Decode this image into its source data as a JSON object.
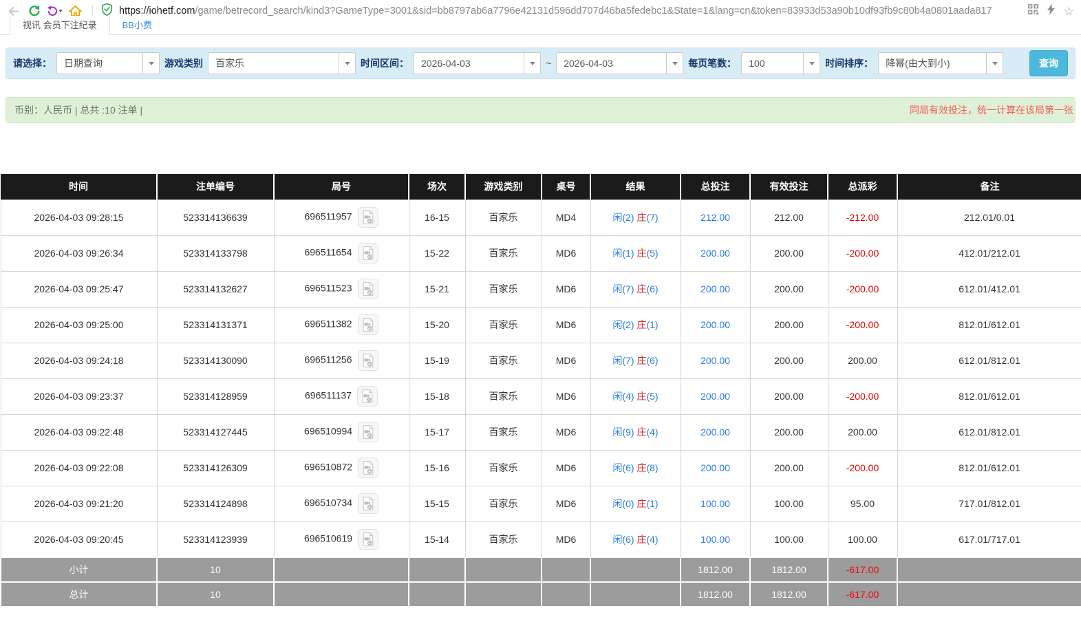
{
  "browser": {
    "url_host": "https://iohetf.com",
    "url_path": "/game/betrecord_search/kind3?GameType=3001&sid=bb8797ab6a7796e42131d596dd707d46ba5fedebc1&State=1&lang=cn&token=83933d53a90b10df93fb9c80b4a0801aada817",
    "icons": [
      "back-arrow",
      "refresh",
      "undo-history",
      "home",
      "security-shield",
      "qr-code",
      "lightning",
      "bookmark-star"
    ]
  },
  "tabs": [
    {
      "label": "视讯 会员下注纪录",
      "active": true
    },
    {
      "label": "BB小费",
      "active": false
    }
  ],
  "filters": {
    "select_label": "请选择：",
    "query_type": "日期查询",
    "game_category_label": "游戏类别",
    "game_category": "百家乐",
    "time_range_label": "时间区间：",
    "date_from": "2026-04-03",
    "tilde": "~",
    "date_to": "2026-04-03",
    "page_size_label": "每页笔数：",
    "page_size": "100",
    "sort_label": "时间排序：",
    "sort_order": "降幂(由大到小)",
    "search_button": "查询"
  },
  "notice": {
    "left": "币别：人民币 | 总共 :10 注单 |",
    "right": "同局有效投注，统一计算在该局第一张"
  },
  "table": {
    "headers": [
      "时间",
      "注单编号",
      "局号",
      "场次",
      "游戏类别",
      "桌号",
      "结果",
      "总投注",
      "有效投注",
      "总派彩",
      "备注"
    ],
    "rows": [
      {
        "time": "2026-04-03 09:28:15",
        "bet_id": "523314136639",
        "round": "696511957",
        "session": "16-15",
        "game_type": "百家乐",
        "table_code": "MD4",
        "result_player": "闲(2)",
        "result_banker_char": "庄",
        "result_banker_num": "(7)",
        "total_bet": "212.00",
        "valid_bet": "212.00",
        "payout": "-212.00",
        "remark": "212.01/0.01"
      },
      {
        "time": "2026-04-03 09:26:34",
        "bet_id": "523314133798",
        "round": "696511654",
        "session": "15-22",
        "game_type": "百家乐",
        "table_code": "MD6",
        "result_player": "闲(1)",
        "result_banker_char": "庄",
        "result_banker_num": "(5)",
        "total_bet": "200.00",
        "valid_bet": "200.00",
        "payout": "-200.00",
        "remark": "412.01/212.01"
      },
      {
        "time": "2026-04-03 09:25:47",
        "bet_id": "523314132627",
        "round": "696511523",
        "session": "15-21",
        "game_type": "百家乐",
        "table_code": "MD6",
        "result_player": "闲(7)",
        "result_banker_char": "庄",
        "result_banker_num": "(6)",
        "total_bet": "200.00",
        "valid_bet": "200.00",
        "payout": "-200.00",
        "remark": "612.01/412.01"
      },
      {
        "time": "2026-04-03 09:25:00",
        "bet_id": "523314131371",
        "round": "696511382",
        "session": "15-20",
        "game_type": "百家乐",
        "table_code": "MD6",
        "result_player": "闲(2)",
        "result_banker_char": "庄",
        "result_banker_num": "(1)",
        "total_bet": "200.00",
        "valid_bet": "200.00",
        "payout": "-200.00",
        "remark": "812.01/612.01"
      },
      {
        "time": "2026-04-03 09:24:18",
        "bet_id": "523314130090",
        "round": "696511256",
        "session": "15-19",
        "game_type": "百家乐",
        "table_code": "MD6",
        "result_player": "闲(7)",
        "result_banker_char": "庄",
        "result_banker_num": "(6)",
        "total_bet": "200.00",
        "valid_bet": "200.00",
        "payout": "200.00",
        "remark": "612.01/812.01"
      },
      {
        "time": "2026-04-03 09:23:37",
        "bet_id": "523314128959",
        "round": "696511137",
        "session": "15-18",
        "game_type": "百家乐",
        "table_code": "MD6",
        "result_player": "闲(4)",
        "result_banker_char": "庄",
        "result_banker_num": "(5)",
        "total_bet": "200.00",
        "valid_bet": "200.00",
        "payout": "-200.00",
        "remark": "812.01/612.01"
      },
      {
        "time": "2026-04-03 09:22:48",
        "bet_id": "523314127445",
        "round": "696510994",
        "session": "15-17",
        "game_type": "百家乐",
        "table_code": "MD6",
        "result_player": "闲(9)",
        "result_banker_char": "庄",
        "result_banker_num": "(4)",
        "total_bet": "200.00",
        "valid_bet": "200.00",
        "payout": "200.00",
        "remark": "612.01/812.01"
      },
      {
        "time": "2026-04-03 09:22:08",
        "bet_id": "523314126309",
        "round": "696510872",
        "session": "15-16",
        "game_type": "百家乐",
        "table_code": "MD6",
        "result_player": "闲(6)",
        "result_banker_char": "庄",
        "result_banker_num": "(8)",
        "total_bet": "200.00",
        "valid_bet": "200.00",
        "payout": "-200.00",
        "remark": "812.01/612.01"
      },
      {
        "time": "2026-04-03 09:21:20",
        "bet_id": "523314124898",
        "round": "696510734",
        "session": "15-15",
        "game_type": "百家乐",
        "table_code": "MD6",
        "result_player": "闲(0)",
        "result_banker_char": "庄",
        "result_banker_num": "(1)",
        "total_bet": "100.00",
        "valid_bet": "100.00",
        "payout": "95.00",
        "remark": "717.01/812.01"
      },
      {
        "time": "2026-04-03 09:20:45",
        "bet_id": "523314123939",
        "round": "696510619",
        "session": "15-14",
        "game_type": "百家乐",
        "table_code": "MD6",
        "result_player": "闲(6)",
        "result_banker_char": "庄",
        "result_banker_num": "(4)",
        "total_bet": "100.00",
        "valid_bet": "100.00",
        "payout": "100.00",
        "remark": "617.01/717.01"
      }
    ],
    "subtotal": {
      "label": "小计",
      "count": "10",
      "total_bet": "1812.00",
      "valid_bet": "1812.00",
      "payout": "-617.00"
    },
    "total": {
      "label": "总计",
      "count": "10",
      "total_bet": "1812.00",
      "valid_bet": "1812.00",
      "payout": "-617.00"
    }
  },
  "colors": {
    "accent_button": "#4cb9dc",
    "filter_bg": "#d7ecf6",
    "notice_bg": "#dff0d8",
    "header_bg": "#1b1b1b",
    "summary_bg": "#9c9c9c",
    "link_blue": "#2a7ce2",
    "negative_red": "#e80000",
    "player_blue": "#2a7ce2",
    "banker_red": "#e02b2b"
  }
}
